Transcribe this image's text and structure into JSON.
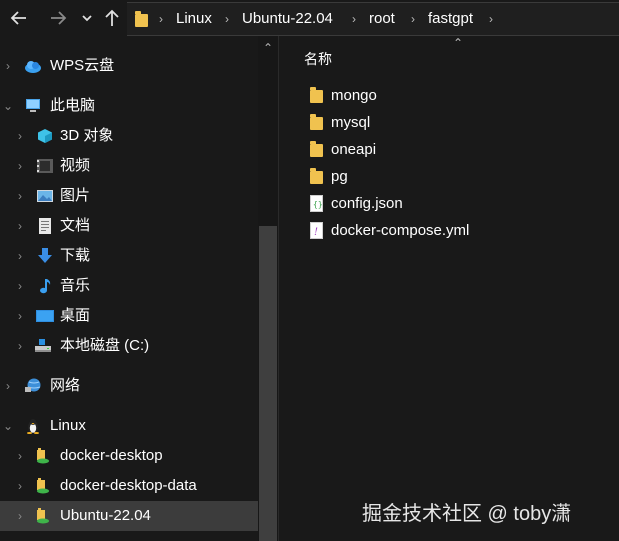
{
  "toolbar": {
    "back_icon": "arrow-left",
    "forward_icon": "arrow-right",
    "history_icon": "chevron-down",
    "up_icon": "arrow-up"
  },
  "breadcrumb": [
    "Linux",
    "Ubuntu-22.04",
    "root",
    "fastgpt"
  ],
  "nav": {
    "items": [
      {
        "label": "WPS云盘",
        "icon": "cloud-icon"
      },
      {
        "label": "此电脑",
        "icon": "computer-icon"
      },
      {
        "label": "3D 对象",
        "icon": "3d-objects-icon"
      },
      {
        "label": "视频",
        "icon": "video-icon"
      },
      {
        "label": "图片",
        "icon": "pictures-icon"
      },
      {
        "label": "文档",
        "icon": "documents-icon"
      },
      {
        "label": "下载",
        "icon": "downloads-icon"
      },
      {
        "label": "音乐",
        "icon": "music-icon"
      },
      {
        "label": "桌面",
        "icon": "desktop-icon"
      },
      {
        "label": "本地磁盘 (C:)",
        "icon": "drive-icon"
      },
      {
        "label": "网络",
        "icon": "network-icon"
      },
      {
        "label": "Linux",
        "icon": "linux-icon"
      },
      {
        "label": "docker-desktop",
        "icon": "linux-distro-icon"
      },
      {
        "label": "docker-desktop-data",
        "icon": "linux-distro-icon"
      },
      {
        "label": "Ubuntu-22.04",
        "icon": "linux-distro-icon"
      }
    ]
  },
  "content": {
    "column_name": "名称",
    "files": [
      {
        "name": "mongo",
        "type": "folder"
      },
      {
        "name": "mysql",
        "type": "folder"
      },
      {
        "name": "oneapi",
        "type": "folder"
      },
      {
        "name": "pg",
        "type": "folder"
      },
      {
        "name": "config.json",
        "type": "json"
      },
      {
        "name": "docker-compose.yml",
        "type": "yml"
      }
    ]
  },
  "watermark": "掘金技术社区 @ toby潇",
  "colors": {
    "background": "#191919",
    "selected": "#3c3c3c",
    "folder": "#f0c24f",
    "text": "#ffffff"
  }
}
